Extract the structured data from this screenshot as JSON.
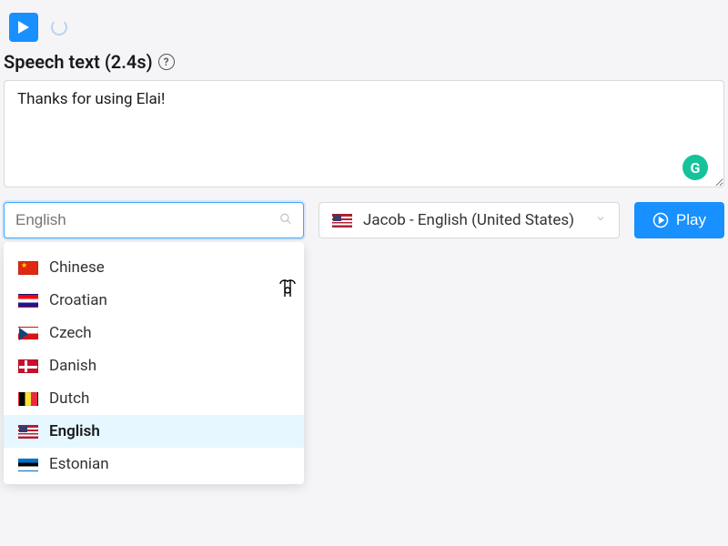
{
  "header": {
    "label": "Speech text (2.4s)"
  },
  "textarea": {
    "value": "Thanks for using Elai!"
  },
  "lang_search": {
    "placeholder": "English"
  },
  "languages": [
    {
      "label": "Chinese",
      "flag": "flag-cn",
      "selected": false
    },
    {
      "label": "Croatian",
      "flag": "flag-hr",
      "selected": false
    },
    {
      "label": "Czech",
      "flag": "flag-cz",
      "selected": false
    },
    {
      "label": "Danish",
      "flag": "flag-dk",
      "selected": false
    },
    {
      "label": "Dutch",
      "flag": "flag-be",
      "selected": false
    },
    {
      "label": "English",
      "flag": "flag-us",
      "selected": true
    },
    {
      "label": "Estonian",
      "flag": "flag-ee",
      "selected": false
    }
  ],
  "voice": {
    "label": "Jacob - English (United States)",
    "flag": "flag-us"
  },
  "play_button": {
    "label": "Play"
  },
  "grammarly": "G"
}
